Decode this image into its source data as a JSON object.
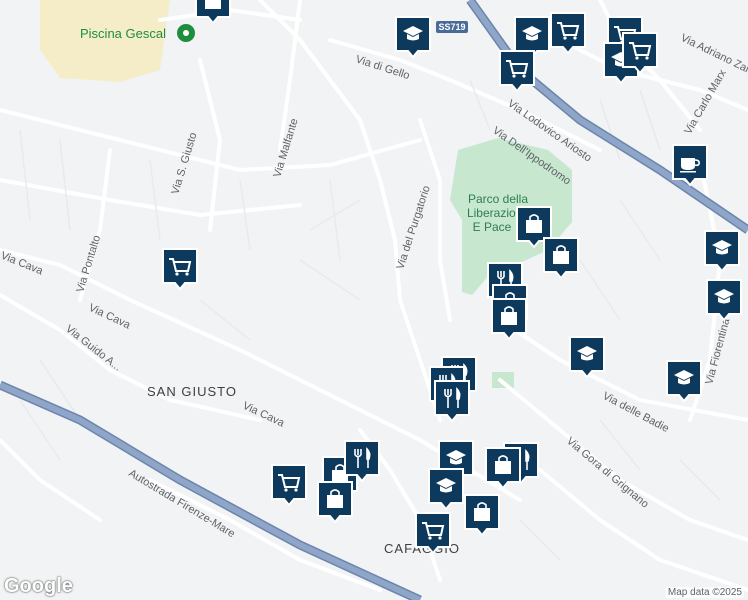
{
  "map": {
    "poi_label": "Piscina Gescal",
    "park_label": [
      "Parco della",
      "Liberazione",
      "E Pace"
    ],
    "area_labels": [
      "SAN GIUSTO",
      "CAFAGGIO"
    ],
    "highway_shield": "SS719",
    "colors": {
      "background": "#f1f3f4",
      "road": "#ffffff",
      "road_casing": "#dadce0",
      "highway": "#8fa6c9",
      "highway_casing": "#6b85ad",
      "park": "#c7e8cf",
      "sand": "#f5ecc8",
      "marker": "#0d3a5c",
      "marker_border": "#ffffff",
      "poi_green": "#1e8e3e"
    },
    "street_labels": [
      "Via di Gello",
      "Via Adriano Zanella",
      "Via Lodovico Ariosto",
      "Via Dell'Ippodromo",
      "Via Carlo Marx",
      "Via S. Giusto",
      "Via Malfante",
      "Via Pontalto",
      "Via Cava",
      "Via Cava",
      "Via Cava",
      "Via Guido A...",
      "Via del Purgatorio",
      "Via delle Badie",
      "Via Gora di Grignano",
      "Via Fiorentina",
      "Autostrada Firenze-Mare"
    ],
    "markers": [
      {
        "icon": "school-icon"
      },
      {
        "icon": "school-icon"
      },
      {
        "icon": "shopping-cart-icon"
      },
      {
        "icon": "shopping-cart-icon"
      },
      {
        "icon": "school-icon"
      },
      {
        "icon": "shopping-cart-icon"
      },
      {
        "icon": "shopping-cart-icon"
      },
      {
        "icon": "shopping-bag-icon"
      },
      {
        "icon": "cafe-icon"
      },
      {
        "icon": "shopping-cart-icon"
      },
      {
        "icon": "shopping-bag-icon"
      },
      {
        "icon": "shopping-bag-icon"
      },
      {
        "icon": "school-icon"
      },
      {
        "icon": "school-icon"
      },
      {
        "icon": "restaurant-icon"
      },
      {
        "icon": "shopping-bag-icon"
      },
      {
        "icon": "shopping-bag-icon"
      },
      {
        "icon": "school-icon"
      },
      {
        "icon": "school-icon"
      },
      {
        "icon": "restaurant-icon"
      },
      {
        "icon": "restaurant-icon"
      },
      {
        "icon": "restaurant-icon"
      },
      {
        "icon": "shopping-cart-icon"
      },
      {
        "icon": "shopping-bag-icon"
      },
      {
        "icon": "shopping-bag-icon"
      },
      {
        "icon": "restaurant-icon"
      },
      {
        "icon": "school-icon"
      },
      {
        "icon": "restaurant-icon"
      },
      {
        "icon": "school-icon"
      },
      {
        "icon": "shopping-bag-icon"
      },
      {
        "icon": "shopping-bag-icon"
      },
      {
        "icon": "shopping-cart-icon"
      }
    ]
  },
  "footer": {
    "logo": "Google",
    "attribution": "Map data ©2025"
  }
}
